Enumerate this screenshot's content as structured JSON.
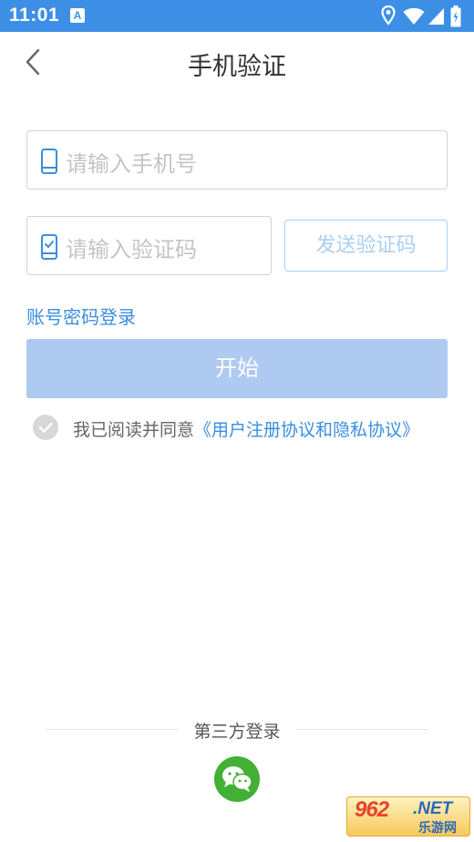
{
  "status_bar": {
    "time": "11:01",
    "notification_icon": "a-icon",
    "icons": [
      "location-icon",
      "wifi-icon",
      "signal-icon",
      "battery-icon"
    ]
  },
  "nav": {
    "back_icon": "chevron-left-icon",
    "title": "手机验证"
  },
  "form": {
    "phone": {
      "placeholder": "请输入手机号",
      "value": "",
      "icon": "phone-icon"
    },
    "code": {
      "placeholder": "请输入验证码",
      "value": "",
      "icon": "phone-check-icon"
    },
    "send_code_label": "发送验证码",
    "account_login_label": "账号密码登录",
    "start_label": "开始"
  },
  "agreement": {
    "checked": false,
    "prefix": "我已阅读并同意",
    "link": "《用户注册协议和隐私协议》"
  },
  "third_party": {
    "label": "第三方登录",
    "wechat_icon": "wechat-icon"
  },
  "watermark": {
    "main": "962",
    "net": ".NET",
    "sub": "乐游网"
  },
  "colors": {
    "status_bar": "#3d8fe6",
    "accent": "#3a8ee0",
    "start_button": "#aecaf0",
    "wechat": "#41b035"
  }
}
